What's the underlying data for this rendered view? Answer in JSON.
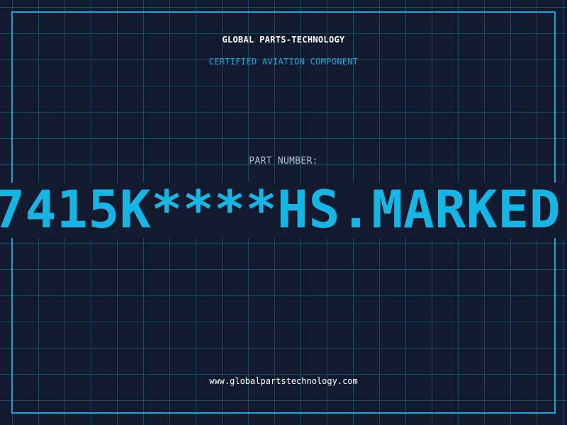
{
  "header": {
    "company": "GLOBAL PARTS-TECHNOLOGY",
    "subtitle": "CERTIFIED AVIATION COMPONENT"
  },
  "part": {
    "label": "PART NUMBER:",
    "value": "7415K****HS.MARKED"
  },
  "footer": {
    "website": "www.globalpartstechnology.com"
  },
  "colors": {
    "background": "#111a2e",
    "grid": "#1d4a63",
    "accent": "#16a4d8",
    "text": "#ffffff"
  }
}
